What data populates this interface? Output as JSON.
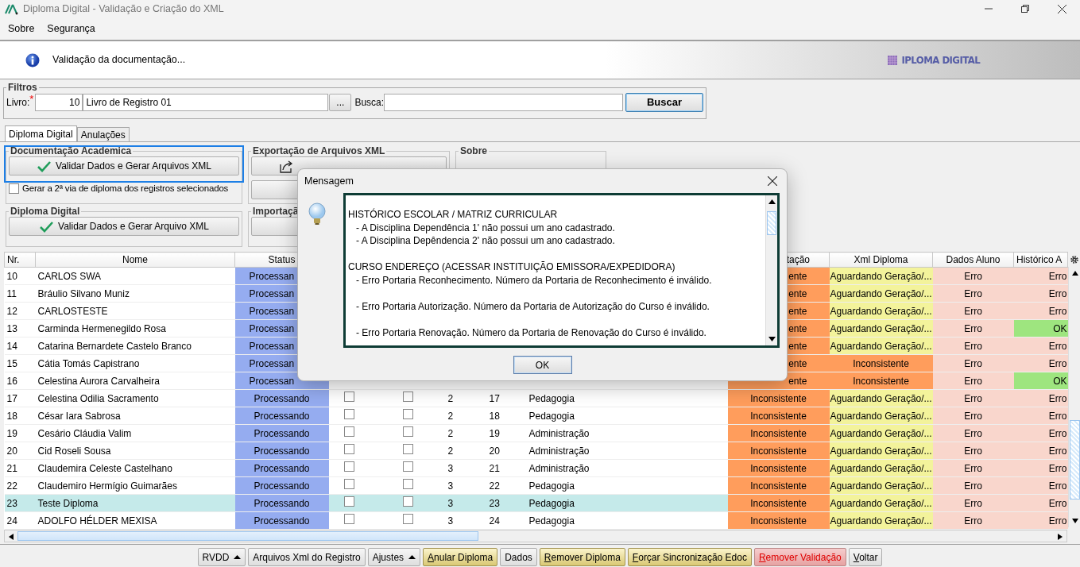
{
  "window": {
    "title": "Diploma Digital - Validação e Criação do XML"
  },
  "menu": [
    "Sobre",
    "Segurança"
  ],
  "banner": {
    "text": "Validação da documentação...",
    "logo": "IPLOMA DIGITAL"
  },
  "filters": {
    "legend": "Filtros",
    "livro_label": "Livro:",
    "required_mark": "*",
    "livro_code": "10",
    "livro_name": "Livro de Registro 01",
    "browse": "...",
    "busca_label": "Busca:",
    "search_button": "Buscar"
  },
  "tabs": [
    {
      "label": "Diploma Digital",
      "selected": true
    },
    {
      "label": "Anulações",
      "selected": false
    }
  ],
  "groups": {
    "academic": {
      "legend": "Documentação Academica",
      "button": "Validar Dados e Gerar Arquivos XML",
      "checkbox": {
        "label": "Gerar a 2ª via de diploma dos registros selecionados",
        "checked": false
      }
    },
    "export": {
      "legend": "Exportação de Arquivos XML"
    },
    "about": {
      "legend": "Sobre"
    },
    "diploma": {
      "legend": "Diploma Digital",
      "button": "Validar Dados e Gerar Arquivo XML"
    },
    "import": {
      "legend": "Importaçã"
    }
  },
  "table": {
    "columns": [
      {
        "label": "Nr.",
        "covered": false
      },
      {
        "label": "Nome",
        "covered": false
      },
      {
        "label": "Status",
        "covered": false
      },
      {
        "label": "tação",
        "covered": true
      },
      {
        "label": "Xml Diploma",
        "covered": false
      },
      {
        "label": "Dados Aluno",
        "covered": false
      },
      {
        "label": "Histórico A",
        "covered": false
      }
    ],
    "rows": [
      {
        "nr": "10",
        "nome": "CARLOS SWA",
        "covered": true,
        "selected": false,
        "status": {
          "text": "Processan",
          "color": "#95acf0"
        },
        "doc": {
          "text": "ente",
          "color": "#ff9d5c"
        },
        "xml": {
          "text": "Aguardando Geração/...",
          "color": "#f3f39b"
        },
        "dados": {
          "text": "Erro",
          "color": "#f9d6cc"
        },
        "hist": {
          "text": "Erro",
          "color": "#f9d6cc"
        }
      },
      {
        "nr": "11",
        "nome": "Bráulio Silvano Muniz",
        "covered": true,
        "selected": false,
        "status": {
          "text": "Processan",
          "color": "#95acf0"
        },
        "doc": {
          "text": "ente",
          "color": "#ff9d5c"
        },
        "xml": {
          "text": "Aguardando Geração/...",
          "color": "#f3f39b"
        },
        "dados": {
          "text": "Erro",
          "color": "#f9d6cc"
        },
        "hist": {
          "text": "Erro",
          "color": "#f9d6cc"
        }
      },
      {
        "nr": "12",
        "nome": "CARLOSTESTE",
        "covered": true,
        "selected": false,
        "status": {
          "text": "Processan",
          "color": "#95acf0"
        },
        "doc": {
          "text": "ente",
          "color": "#ff9d5c"
        },
        "xml": {
          "text": "Aguardando Geração/...",
          "color": "#f3f39b"
        },
        "dados": {
          "text": "Erro",
          "color": "#f9d6cc"
        },
        "hist": {
          "text": "Erro",
          "color": "#f9d6cc"
        }
      },
      {
        "nr": "13",
        "nome": "Carminda Hermenegildo Rosa",
        "covered": true,
        "selected": false,
        "status": {
          "text": "Processan",
          "color": "#95acf0"
        },
        "doc": {
          "text": "ente",
          "color": "#ff9d5c"
        },
        "xml": {
          "text": "Aguardando Geração/...",
          "color": "#f3f39b"
        },
        "dados": {
          "text": "Erro",
          "color": "#f9d6cc"
        },
        "hist": {
          "text": "OK",
          "color": "#9ee57f"
        }
      },
      {
        "nr": "14",
        "nome": "Catarina Bernardete Castelo Branco",
        "covered": true,
        "selected": false,
        "status": {
          "text": "Processan",
          "color": "#95acf0"
        },
        "doc": {
          "text": "ente",
          "color": "#ff9d5c"
        },
        "xml": {
          "text": "Aguardando Geração/...",
          "color": "#f3f39b"
        },
        "dados": {
          "text": "Erro",
          "color": "#f9d6cc"
        },
        "hist": {
          "text": "Erro",
          "color": "#f9d6cc"
        }
      },
      {
        "nr": "15",
        "nome": "Cátia Tomás Capistrano",
        "covered": true,
        "selected": false,
        "status": {
          "text": "Processan",
          "color": "#95acf0"
        },
        "doc": {
          "text": "ente",
          "color": "#ff9d5c"
        },
        "xml": {
          "text": "Inconsistente",
          "color": "#ff9d5c"
        },
        "dados": {
          "text": "Erro",
          "color": "#f9d6cc"
        },
        "hist": {
          "text": "Erro",
          "color": "#f9d6cc"
        }
      },
      {
        "nr": "16",
        "nome": "Celestina Aurora Carvalheira",
        "covered": true,
        "selected": false,
        "status": {
          "text": "Processan",
          "color": "#95acf0"
        },
        "doc": {
          "text": "ente",
          "color": "#ff9d5c"
        },
        "xml": {
          "text": "Inconsistente",
          "color": "#ff9d5c"
        },
        "dados": {
          "text": "Erro",
          "color": "#f9d6cc"
        },
        "hist": {
          "text": "OK",
          "color": "#9ee57f"
        }
      },
      {
        "nr": "17",
        "nome": "Celestina Odilia Sacramento",
        "covered": false,
        "selected": false,
        "status": {
          "text": "Processando",
          "color": "#95acf0"
        },
        "check_1": false,
        "check_2": false,
        "num_1": "2",
        "num_2": "17",
        "curso": "Pedagogia",
        "doc": {
          "text": "Inconsistente",
          "color": "#ff9d5c"
        },
        "xml": {
          "text": "Aguardando Geração/...",
          "color": "#f3f39b"
        },
        "dados": {
          "text": "Erro",
          "color": "#f9d6cc"
        },
        "hist": {
          "text": "Erro",
          "color": "#f9d6cc"
        }
      },
      {
        "nr": "18",
        "nome": "César Iara Sabrosa",
        "covered": false,
        "selected": false,
        "status": {
          "text": "Processando",
          "color": "#95acf0"
        },
        "check_1": false,
        "check_2": false,
        "num_1": "2",
        "num_2": "18",
        "curso": "Pedagogia",
        "doc": {
          "text": "Inconsistente",
          "color": "#ff9d5c"
        },
        "xml": {
          "text": "Aguardando Geração/...",
          "color": "#f3f39b"
        },
        "dados": {
          "text": "Erro",
          "color": "#f9d6cc"
        },
        "hist": {
          "text": "Erro",
          "color": "#f9d6cc"
        }
      },
      {
        "nr": "19",
        "nome": "Cesário Cláudia Valim",
        "covered": false,
        "selected": false,
        "status": {
          "text": "Processando",
          "color": "#95acf0"
        },
        "check_1": false,
        "check_2": false,
        "num_1": "2",
        "num_2": "19",
        "curso": "Administração",
        "doc": {
          "text": "Inconsistente",
          "color": "#ff9d5c"
        },
        "xml": {
          "text": "Aguardando Geração/...",
          "color": "#f3f39b"
        },
        "dados": {
          "text": "Erro",
          "color": "#f9d6cc"
        },
        "hist": {
          "text": "Erro",
          "color": "#f9d6cc"
        }
      },
      {
        "nr": "20",
        "nome": "Cid Roseli Sousa",
        "covered": false,
        "selected": false,
        "status": {
          "text": "Processando",
          "color": "#95acf0"
        },
        "check_1": false,
        "check_2": false,
        "num_1": "2",
        "num_2": "20",
        "curso": "Administração",
        "doc": {
          "text": "Inconsistente",
          "color": "#ff9d5c"
        },
        "xml": {
          "text": "Aguardando Geração/...",
          "color": "#f3f39b"
        },
        "dados": {
          "text": "Erro",
          "color": "#f9d6cc"
        },
        "hist": {
          "text": "Erro",
          "color": "#f9d6cc"
        }
      },
      {
        "nr": "21",
        "nome": "Claudemira Celeste Castelhano",
        "covered": false,
        "selected": false,
        "status": {
          "text": "Processando",
          "color": "#95acf0"
        },
        "check_1": false,
        "check_2": false,
        "num_1": "3",
        "num_2": "21",
        "curso": "Administração",
        "doc": {
          "text": "Inconsistente",
          "color": "#ff9d5c"
        },
        "xml": {
          "text": "Aguardando Geração/...",
          "color": "#f3f39b"
        },
        "dados": {
          "text": "Erro",
          "color": "#f9d6cc"
        },
        "hist": {
          "text": "Erro",
          "color": "#f9d6cc"
        }
      },
      {
        "nr": "22",
        "nome": "Claudemiro Hermígio Guimarães",
        "covered": false,
        "selected": false,
        "status": {
          "text": "Processando",
          "color": "#95acf0"
        },
        "check_1": false,
        "check_2": false,
        "num_1": "3",
        "num_2": "22",
        "curso": "Pedagogia",
        "doc": {
          "text": "Inconsistente",
          "color": "#ff9d5c"
        },
        "xml": {
          "text": "Aguardando Geração/...",
          "color": "#f3f39b"
        },
        "dados": {
          "text": "Erro",
          "color": "#f9d6cc"
        },
        "hist": {
          "text": "Erro",
          "color": "#f9d6cc"
        }
      },
      {
        "nr": "23",
        "nome": "Teste Diploma",
        "covered": false,
        "selected": true,
        "status": {
          "text": "Processando",
          "color": "#95acf0"
        },
        "check_1": false,
        "check_2": false,
        "num_1": "3",
        "num_2": "23",
        "curso": "Pedagogia",
        "doc": {
          "text": "Inconsistente",
          "color": "#ff9d5c"
        },
        "xml": {
          "text": "Aguardando Geração/...",
          "color": "#f3f39b"
        },
        "dados": {
          "text": "Erro",
          "color": "#f9d6cc"
        },
        "hist": {
          "text": "Erro",
          "color": "#f9d6cc"
        }
      },
      {
        "nr": "24",
        "nome": "ADOLFO HÉLDER MEXISA",
        "covered": false,
        "selected": false,
        "status": {
          "text": "Processando",
          "color": "#95acf0"
        },
        "check_1": false,
        "check_2": false,
        "num_1": "3",
        "num_2": "24",
        "curso": "Pedagogia",
        "doc": {
          "text": "Inconsistente",
          "color": "#ff9d5c"
        },
        "xml": {
          "text": "Aguardando Geração/...",
          "color": "#f3f39b"
        },
        "dados": {
          "text": "Erro",
          "color": "#f9d6cc"
        },
        "hist": {
          "text": "Erro",
          "color": "#f9d6cc"
        }
      }
    ]
  },
  "buttons": [
    {
      "label": "RVDD",
      "kind": "menu",
      "accelerator": false
    },
    {
      "label": "Arquivos Xml do Registro",
      "kind": "plain",
      "accelerator": false
    },
    {
      "label": "Ajustes",
      "kind": "menu",
      "accelerator": false
    },
    {
      "label": "Anular Diploma",
      "kind": "warning",
      "accelerator": true
    },
    {
      "label": "Dados",
      "kind": "plain",
      "accelerator": false
    },
    {
      "label": "Remover Diploma",
      "kind": "warning",
      "accelerator": true
    },
    {
      "label": "Forçar Sincronização Edoc",
      "kind": "warning",
      "accelerator": true
    },
    {
      "label": "Remover Validação",
      "kind": "danger",
      "accelerator": true
    },
    {
      "label": "Voltar",
      "kind": "plain",
      "accelerator": true
    }
  ],
  "dialog": {
    "title": "Mensagem",
    "ok": "OK",
    "sections": [
      {
        "heading": "HISTÓRICO ESCOLAR / MATRIZ CURRICULAR",
        "spaced": false,
        "items": [
          "- A Disciplina Dependência 1' não possui um ano cadastrado.",
          "- A Disciplina Depêndencia 2' não possui um ano cadastrado."
        ]
      },
      {
        "heading": "CURSO ENDEREÇO (ACESSAR INSTITUIÇÃO EMISSORA/EXPEDIDORA)",
        "spaced": true,
        "items": [
          "- Erro Portaria Reconhecimento. Número da Portaria de Reconhecimento é inválido.",
          "- Erro Portaria Autorização. Número da Portaria de Autorização do Curso é inválido.",
          "- Erro Portaria Renovação. Número da Portaria de Renovação do Curso é inválido."
        ]
      }
    ]
  }
}
